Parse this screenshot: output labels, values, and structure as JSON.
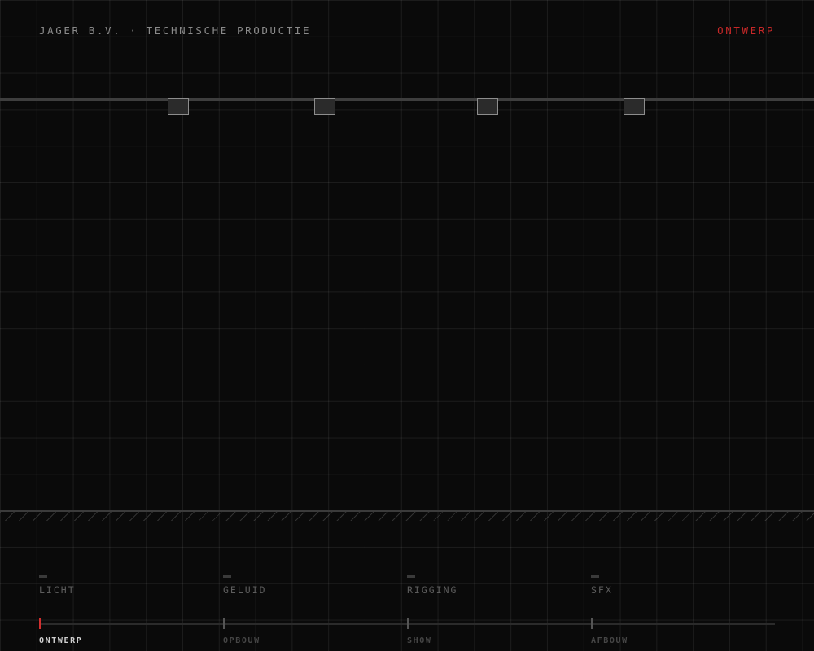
{
  "header": {
    "brand": "JAGER B.V. · TECHNISCHE PRODUCTIE",
    "mode": "ONTWERP"
  },
  "colors": {
    "background": "#0a0a0a",
    "accent": "#c62828",
    "grid": "#1c1c1c",
    "fixture_border": "#8d8d8d"
  },
  "rig": {
    "fixtures": [
      "fixture",
      "fixture",
      "fixture",
      "fixture"
    ]
  },
  "departments": [
    {
      "label": "LICHT"
    },
    {
      "label": "GELUID"
    },
    {
      "label": "RIGGING"
    },
    {
      "label": "SFX"
    }
  ],
  "timeline": {
    "phases": [
      {
        "label": "ONTWERP",
        "active": true
      },
      {
        "label": "OPBOUW",
        "active": false
      },
      {
        "label": "SHOW",
        "active": false
      },
      {
        "label": "AFBOUW",
        "active": false
      }
    ]
  }
}
